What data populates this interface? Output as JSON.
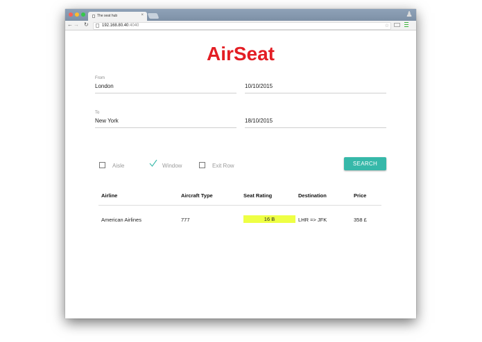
{
  "browser": {
    "tab_title": "The seat hub",
    "tab_close": "×",
    "url_host": "192.168.80.40",
    "url_port": ":4040"
  },
  "app": {
    "brand": "AirSeat",
    "colors": {
      "brand": "#e31e24",
      "accent": "#36b8a9",
      "highlight": "#eeff44"
    }
  },
  "search": {
    "from_label": "From",
    "from_value": "London",
    "depart_date": "10/10/2015",
    "to_label": "To",
    "to_value": "New York",
    "return_date": "18/10/2015",
    "options": [
      {
        "label": "Aisle",
        "checked": false
      },
      {
        "label": "Window",
        "checked": true
      },
      {
        "label": "Exit Row",
        "checked": false
      }
    ],
    "button_label": "SEARCH"
  },
  "results": {
    "columns": [
      "Airline",
      "Aircraft Type",
      "Seat Rating",
      "Destination",
      "Price"
    ],
    "rows": [
      {
        "airline": "American Airlines",
        "aircraft": "777",
        "seat_rating": "16 B",
        "destination": "LHR => JFK",
        "price": "358 £"
      }
    ]
  }
}
